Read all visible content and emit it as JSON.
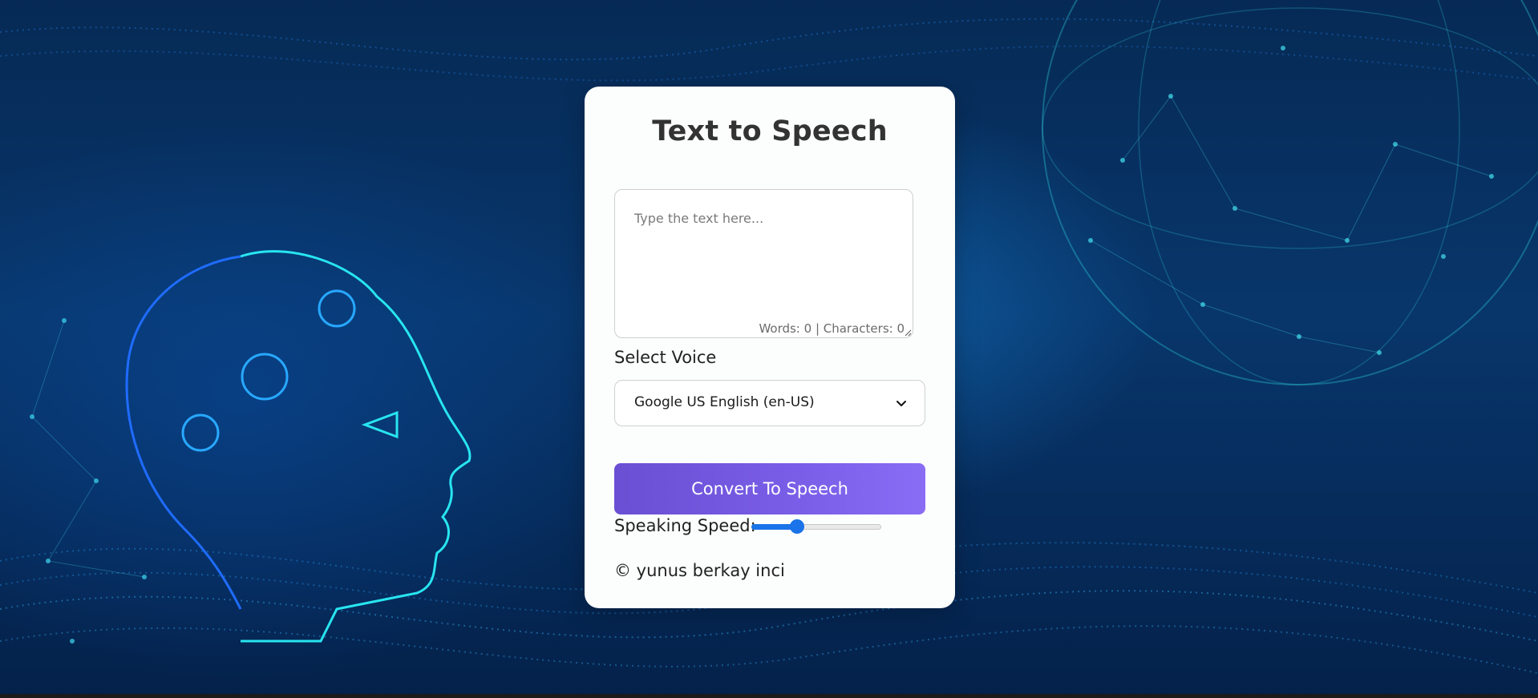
{
  "page": {
    "title": "Text to Speech"
  },
  "editor": {
    "placeholder": "Type the text here...",
    "value": "",
    "counter": "Words: 0 | Characters: 0"
  },
  "voice": {
    "label": "Select Voice",
    "selected": "Google US English (en-US)",
    "icon": "chevron-down-icon"
  },
  "actions": {
    "convert_label": "Convert To Speech"
  },
  "speed": {
    "label": "Speaking Speed:",
    "fraction": 0.33
  },
  "footer": {
    "text": "© yunus berkay inci"
  },
  "colors": {
    "card_background": "#fcfdfd",
    "button_gradient_start": "#6a4fd3",
    "button_gradient_end": "#8a6df5",
    "slider_accent": "#1a73e8",
    "page_background": "#062a55"
  }
}
